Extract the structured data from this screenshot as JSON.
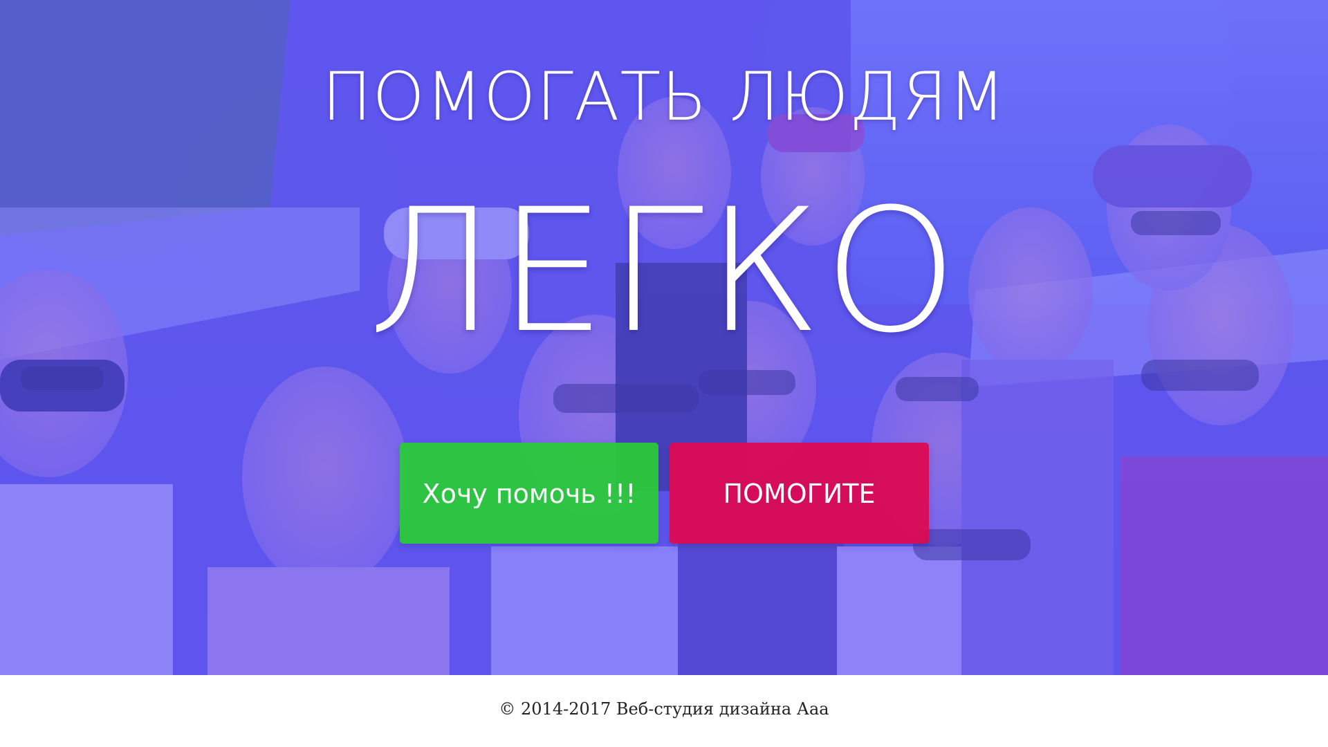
{
  "hero": {
    "headline_top": "ПОМОГАТЬ ЛЮДЯМ",
    "headline_main": "ЛЕГКО",
    "overlay_color": "#6159ff",
    "buttons": {
      "help": {
        "label": "Хочу помочь !!!",
        "color": "#2bca38"
      },
      "need_help": {
        "label": "ПОМОГИТЕ",
        "color": "#dc0953"
      }
    }
  },
  "footer": {
    "copyright": "© 2014-2017 Веб-студия дизайна Ааа"
  }
}
